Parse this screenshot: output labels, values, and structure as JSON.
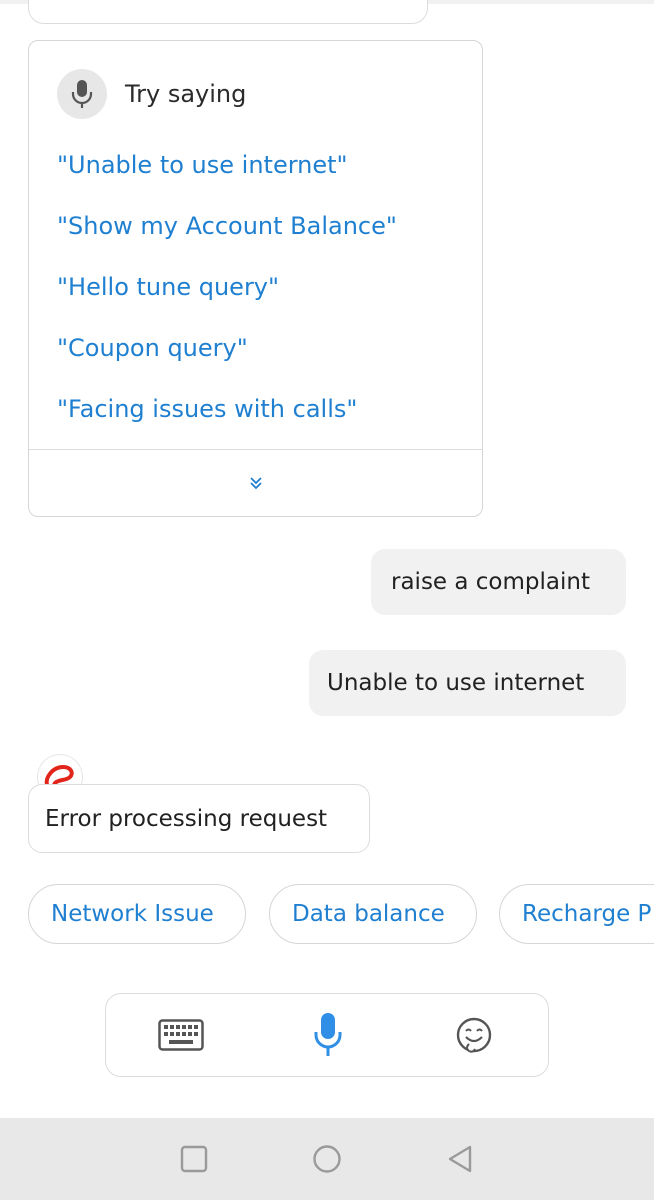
{
  "try_card": {
    "title": "Try saying",
    "suggestions": [
      "\"Unable to use internet\"",
      "\"Show my Account Balance\"",
      "\"Hello tune query\"",
      "\"Coupon query\"",
      "\"Facing issues with calls\""
    ],
    "expand_icon": "double-chevron-down-icon"
  },
  "messages": {
    "user_1": "raise a complaint",
    "user_2": "Unable to use internet",
    "bot_1": "Error processing request"
  },
  "chips": [
    "Network Issue",
    "Data balance",
    "Recharge P"
  ],
  "input_bar": {
    "icons": [
      "keyboard-icon",
      "microphone-icon",
      "emoji-icon"
    ]
  },
  "nav": {
    "icons": [
      "square-recents-icon",
      "circle-home-icon",
      "triangle-back-icon"
    ]
  },
  "colors": {
    "accent_blue": "#1f7fd0",
    "mic_blue": "#2f8fe6",
    "brand_red": "#e1251b",
    "bubble_gray": "#f1f1f1"
  }
}
